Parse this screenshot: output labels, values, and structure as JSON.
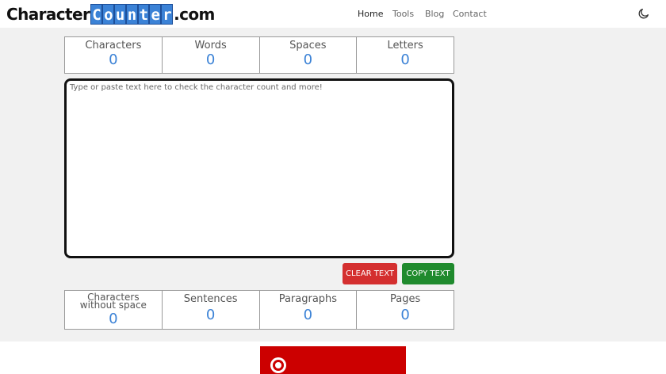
{
  "header": {
    "logo_prefix": "Character",
    "logo_boxed": [
      "C",
      "o",
      "u",
      "n",
      "t",
      "e",
      "r"
    ],
    "logo_suffix": ".com",
    "nav": [
      {
        "label": "Home",
        "active": true
      },
      {
        "label": "Tools",
        "active": false
      },
      {
        "label": "Blog",
        "active": false
      },
      {
        "label": "Contact",
        "active": false
      }
    ],
    "theme_icon": "moon-icon"
  },
  "top_stats": [
    {
      "label": "Characters",
      "value": "0"
    },
    {
      "label": "Words",
      "value": "0"
    },
    {
      "label": "Spaces",
      "value": "0"
    },
    {
      "label": "Letters",
      "value": "0"
    }
  ],
  "editor": {
    "placeholder": "Type or paste text here to check the character count and more!",
    "value": ""
  },
  "buttons": {
    "clear": "CLEAR TEXT",
    "copy": "COPY TEXT"
  },
  "bottom_stats": [
    {
      "label_line1": "Characters",
      "label_line2": "without space",
      "value": "0"
    },
    {
      "label": "Sentences",
      "value": "0"
    },
    {
      "label": "Paragraphs",
      "value": "0"
    },
    {
      "label": "Pages",
      "value": "0"
    }
  ],
  "colors": {
    "accent": "#3b82d6",
    "clear_button": "#d42f2f",
    "copy_button": "#1f8a2d",
    "ad_background": "#cc0000"
  },
  "ad": {
    "icon": "target-logo-icon"
  }
}
